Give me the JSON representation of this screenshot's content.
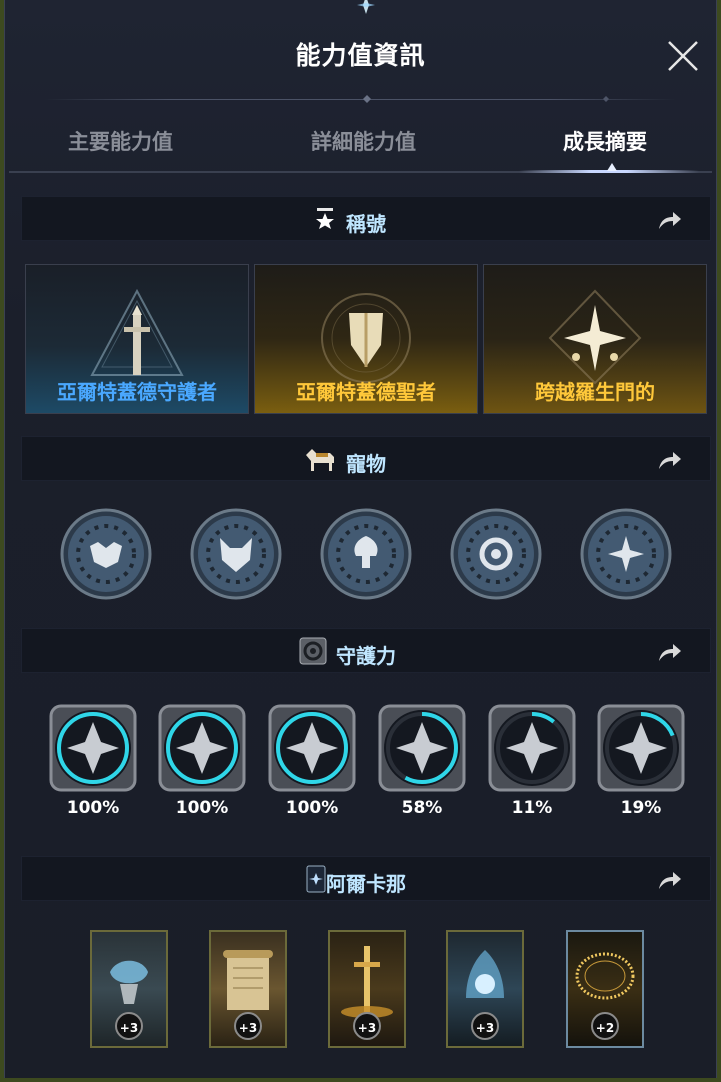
{
  "window": {
    "title": "能力值資訊",
    "close_icon": "close-icon"
  },
  "tabs": [
    {
      "label": "主要能力值",
      "active": false
    },
    {
      "label": "詳細能力值",
      "active": false
    },
    {
      "label": "成長摘要",
      "active": true
    }
  ],
  "sections": {
    "titles": {
      "heading": "稱號",
      "icon": "star-trophy-icon",
      "cards": [
        {
          "label": "亞爾特蓋德守護者",
          "color": "#3aa0ff",
          "emblem": "sword-triangle-icon"
        },
        {
          "label": "亞爾特蓋德聖者",
          "color": "#ffc83a",
          "emblem": "shield-wings-icon"
        },
        {
          "label": "跨越羅生門的",
          "color": "#ffc83a",
          "emblem": "star-diamond-icon"
        }
      ]
    },
    "pets": {
      "heading": "寵物",
      "icon": "horse-icon",
      "items": [
        "owl-mask-icon",
        "fox-mask-icon",
        "tree-icon",
        "swirl-icon",
        "flower-star-icon"
      ]
    },
    "guardian": {
      "heading": "守護力",
      "icon": "guardian-swirl-icon",
      "items": [
        {
          "icon": "sword-shield-icon",
          "percent": "100%",
          "progress": 1.0
        },
        {
          "icon": "wing-blade-icon",
          "percent": "100%",
          "progress": 1.0
        },
        {
          "icon": "rune-crest-icon",
          "percent": "100%",
          "progress": 1.0
        },
        {
          "icon": "lotus-icon",
          "percent": "58%",
          "progress": 0.58
        },
        {
          "icon": "crossed-blades-icon",
          "percent": "11%",
          "progress": 0.11
        },
        {
          "icon": "scales-icon",
          "percent": "19%",
          "progress": 0.19
        }
      ]
    },
    "arcana": {
      "heading": "阿爾卡那",
      "icon": "arcana-card-icon",
      "cards": [
        {
          "badge": "+3",
          "art": "water-chalice-icon"
        },
        {
          "badge": "+3",
          "art": "scroll-icon"
        },
        {
          "badge": "+3",
          "art": "golden-sword-icon"
        },
        {
          "badge": "+3",
          "art": "crystal-bell-icon"
        },
        {
          "badge": "+2",
          "art": "golden-ring-icon"
        }
      ]
    }
  },
  "colors": {
    "section_title": "#bfe6ff",
    "progress_ring": "#2fd6e8"
  }
}
